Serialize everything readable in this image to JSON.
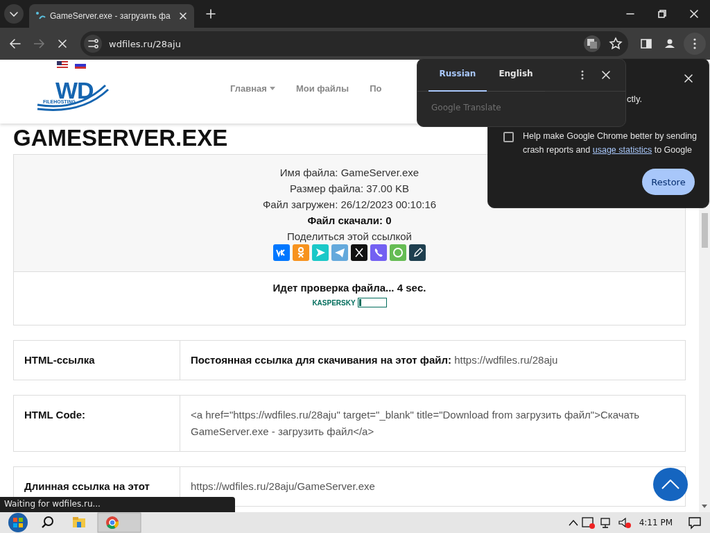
{
  "browser": {
    "tabs": [
      {
        "title": "GameServer.exe - загрузить фа",
        "selected": true
      }
    ],
    "address": "wdfiles.ru/28aju",
    "loading": true
  },
  "site": {
    "logo": {
      "big": "WD",
      "small": "FILEHOSTING"
    },
    "nav": [
      {
        "label": "Главная",
        "dropdown": true
      },
      {
        "label": "Мои файлы",
        "dropdown": false
      },
      {
        "label": "По",
        "dropdown": false
      }
    ]
  },
  "page_title": "GAMESERVER.EXE",
  "file_info": [
    {
      "kind": "pair",
      "label": "Имя файла:",
      "value": "GameServer.exe"
    },
    {
      "kind": "pair",
      "label": "Размер файла:",
      "value": "37.00 KB"
    },
    {
      "kind": "pair",
      "label": "Файл загружен:",
      "value": "26/12/2023 00:10:16"
    },
    {
      "kind": "bold",
      "label": "Файл скачали: 0"
    },
    {
      "kind": "plain",
      "label": "Поделиться этой ссылкой"
    }
  ],
  "scan": {
    "text": "Идет проверка файла... 4 sec.",
    "brand": "KASPERSKY",
    "level": 0.08
  },
  "links": [
    {
      "label": "HTML-ссылка",
      "value": "**Постоянная ссылка для скачивания на этот файл:** https://wdfiles.ru/28aju"
    },
    {
      "label": "HTML Code:",
      "value": "<a href=\"https://wdfiles.ru/28aju\" target=\"_blank\" title=\"Download from загрузить файл\">Скачать GameServer.exe - загрузить файл</a>"
    },
    {
      "label": "Длинная ссылка на этот",
      "value": "https://wdfiles.ru/28aju/GameServer.exe"
    }
  ],
  "translate_popup": {
    "tabs": [
      {
        "label": "Russian",
        "selected": true
      },
      {
        "label": "English",
        "selected": false
      }
    ],
    "footer": "Google Translate"
  },
  "restore_popup": {
    "text": "ctly.",
    "checkbox": {
      "checked": false,
      "label": "Help make Google Chrome better by sending crash reports and ",
      "link": "usage statistics",
      "label_end": " to Google"
    },
    "button": "Restore"
  },
  "status_bubble": "Waiting for wdfiles.ru...",
  "taskbar": {
    "time": "4:11 PM"
  }
}
